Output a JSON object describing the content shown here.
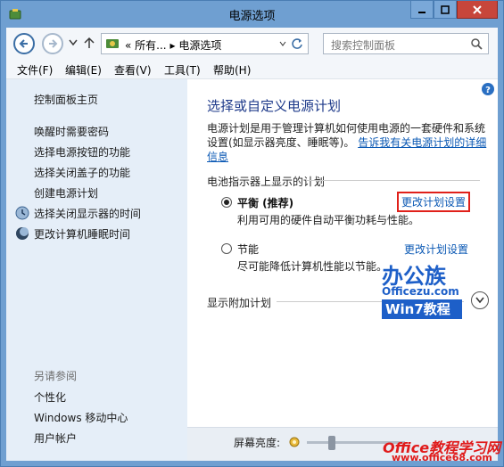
{
  "window": {
    "title": "电源选项"
  },
  "nav": {
    "address_parts": [
      "所有...",
      "电源选项"
    ],
    "search_placeholder": "搜索控制面板"
  },
  "menu": [
    "文件(F)",
    "编辑(E)",
    "查看(V)",
    "工具(T)",
    "帮助(H)"
  ],
  "sidebar": {
    "home": "控制面板主页",
    "links": [
      "唤醒时需要密码",
      "选择电源按钮的功能",
      "选择关闭盖子的功能",
      "创建电源计划",
      "选择关闭显示器的时间",
      "更改计算机睡眠时间"
    ],
    "see_also_title": "另请参阅",
    "see_also": [
      "个性化",
      "Windows 移动中心",
      "用户帐户"
    ]
  },
  "main": {
    "heading": "选择或自定义电源计划",
    "description": "电源计划是用于管理计算机如何使用电源的一套硬件和系统设置(如显示器亮度、睡眠等)。",
    "description_link": "告诉我有关电源计划的详细信息",
    "battery_section": "电池指示器上显示的计划",
    "plans": [
      {
        "name": "平衡 (推荐)",
        "desc": "利用可用的硬件自动平衡功耗与性能。",
        "link": "更改计划设置",
        "selected": true
      },
      {
        "name": "节能",
        "desc": "尽可能降低计算机性能以节能。",
        "link": "更改计划设置",
        "selected": false
      }
    ],
    "extra_plans": "显示附加计划"
  },
  "brightness": {
    "label": "屏幕亮度:",
    "level": 0.25
  },
  "watermarks": {
    "brand": "办公族",
    "url": "Officezu.com",
    "sub": "Win7教程",
    "bottom_title": "Office教程学习网",
    "bottom_url": "www.office68.com"
  },
  "colors": {
    "accent": "#6f9fd1",
    "link": "#0a58b4",
    "highlight": "#e0201a"
  }
}
